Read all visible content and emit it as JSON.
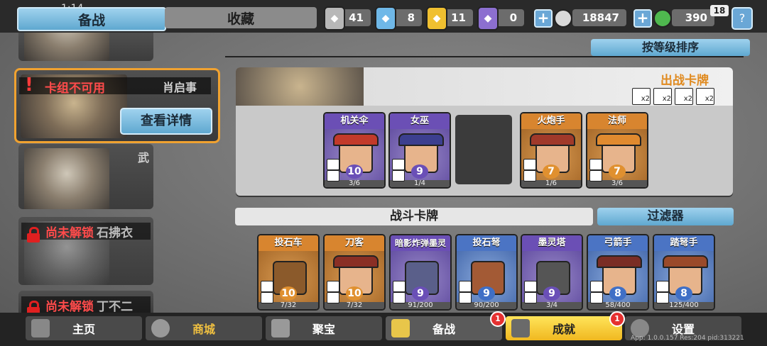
{
  "status": {
    "time": "1:14"
  },
  "tabs": {
    "active": "备战",
    "idle": "收藏"
  },
  "resources": [
    {
      "icon": "silver-shield-icon",
      "value": "41",
      "color": "#b8b8b8"
    },
    {
      "icon": "blue-gem-shield-icon",
      "value": "8",
      "color": "#6fb8e8"
    },
    {
      "icon": "gold-shield-icon",
      "value": "11",
      "color": "#f0c030"
    },
    {
      "icon": "purple-mask-icon",
      "value": "0",
      "color": "#8c6fd0"
    }
  ],
  "silver_coins": "18847",
  "jade_coins": "390",
  "level_badge": "18",
  "sort_button": "按等级排序",
  "decks": [
    {
      "name": "肖启事",
      "status": "卡组不可用",
      "detail_button": "查看详情"
    },
    {
      "name": "武"
    },
    {
      "name": "石拂衣",
      "status": "尚未解锁"
    },
    {
      "name": "丁不二",
      "status": "尚未解锁"
    }
  ],
  "panel": {
    "title": "出战卡牌",
    "multipliers": [
      "x2",
      "x2",
      "x2",
      "x2"
    ],
    "cards": [
      {
        "name": "机关伞",
        "level": "10",
        "progress": "3/6",
        "rarity": "purple"
      },
      {
        "name": "女巫",
        "level": "9",
        "progress": "1/4",
        "rarity": "purple"
      },
      {
        "name": "火炮手",
        "level": "7",
        "progress": "1/6",
        "rarity": "orange"
      },
      {
        "name": "法师",
        "level": "7",
        "progress": "3/6",
        "rarity": "orange"
      }
    ]
  },
  "battle_label": "战斗卡牌",
  "filter_button": "过滤器",
  "battle_cards": [
    {
      "name": "投石车",
      "level": "10",
      "progress": "7/32",
      "rarity": "orange"
    },
    {
      "name": "刀客",
      "level": "10",
      "progress": "7/32",
      "rarity": "orange"
    },
    {
      "name": "暗影炸弹墨灵",
      "level": "9",
      "progress": "91/200",
      "rarity": "purple"
    },
    {
      "name": "投石弩",
      "level": "9",
      "progress": "90/200",
      "rarity": "blue"
    },
    {
      "name": "墨灵塔",
      "level": "9",
      "progress": "3/4",
      "rarity": "purple"
    },
    {
      "name": "弓箭手",
      "level": "8",
      "progress": "58/400",
      "rarity": "blue"
    },
    {
      "name": "踏弩手",
      "level": "8",
      "progress": "125/400",
      "rarity": "blue"
    }
  ],
  "nav": [
    {
      "label": "主页",
      "icon": "temple-icon"
    },
    {
      "label": "商城",
      "icon": "coins-icon"
    },
    {
      "label": "聚宝",
      "icon": "treasure-icon"
    },
    {
      "label": "备战",
      "icon": "card-icon",
      "badge": "1"
    },
    {
      "label": "成就",
      "icon": "grid-icon",
      "badge": "1"
    },
    {
      "label": "设置",
      "icon": "gear-icon"
    }
  ],
  "footer": "App: 1.0.0.157 Res:204 pid:313221"
}
